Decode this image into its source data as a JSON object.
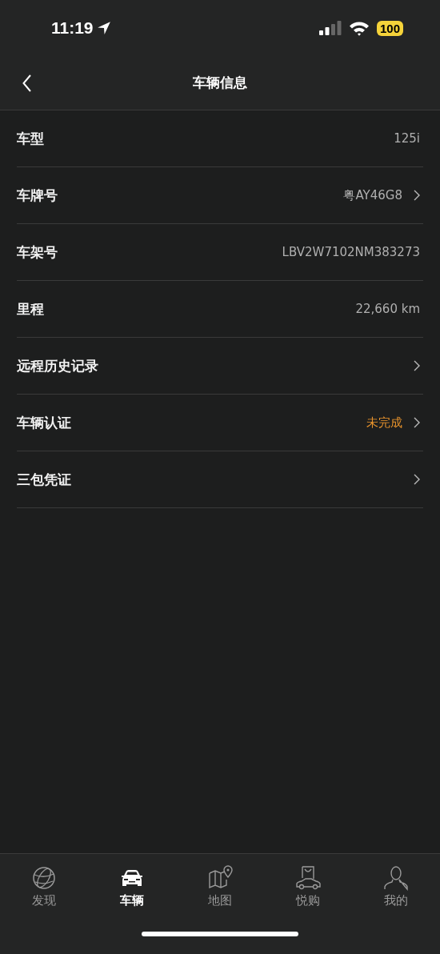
{
  "status_bar": {
    "time": "11:19",
    "battery": "100"
  },
  "nav": {
    "title": "车辆信息"
  },
  "rows": [
    {
      "label": "车型",
      "value": "125i",
      "chevron": false,
      "highlight": false
    },
    {
      "label": "车牌号",
      "value": "粤AY46G8",
      "chevron": true,
      "highlight": false
    },
    {
      "label": "车架号",
      "value": "LBV2W7102NM383273",
      "chevron": false,
      "highlight": false
    },
    {
      "label": "里程",
      "value": "22,660 km",
      "chevron": false,
      "highlight": false
    },
    {
      "label": "远程历史记录",
      "chevron": true
    },
    {
      "label": "车辆认证",
      "value": "未完成",
      "chevron": true,
      "highlight": true
    },
    {
      "label": "三包凭证",
      "chevron": true
    }
  ],
  "tabs": [
    {
      "label": "发现",
      "selected": false
    },
    {
      "label": "车辆",
      "selected": true
    },
    {
      "label": "地图",
      "selected": false
    },
    {
      "label": "悦购",
      "selected": false
    },
    {
      "label": "我的",
      "selected": false
    }
  ]
}
